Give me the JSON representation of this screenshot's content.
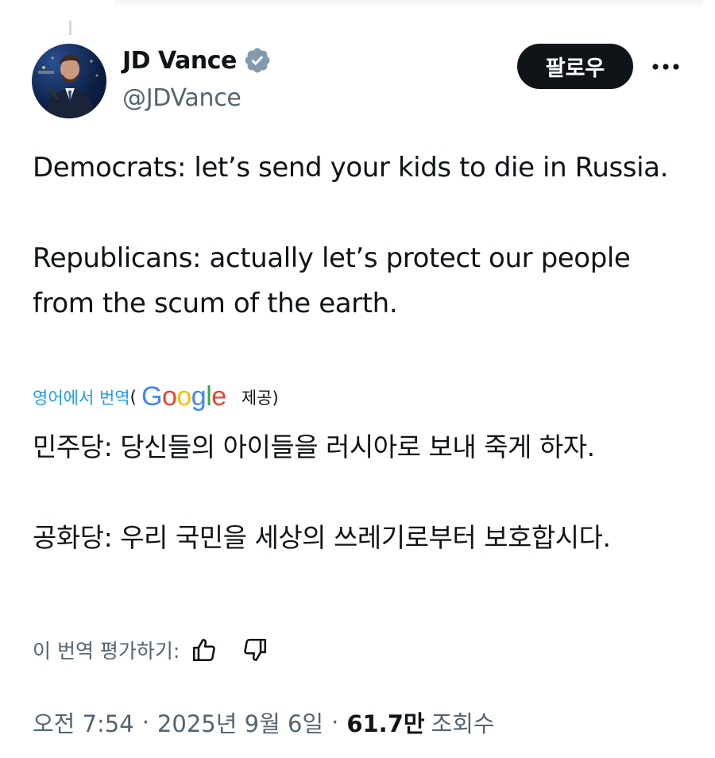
{
  "author": {
    "display_name": "JD Vance",
    "handle": "@JDVance",
    "verified_color": "#829aab"
  },
  "actions": {
    "follow_label": "팔로우",
    "more_icon": "more-horizontal-icon"
  },
  "tweet": {
    "paragraphs": [
      "Democrats: let’s send your kids to die in Russia.",
      "Republicans: actually let’s protect our people from the scum of the earth."
    ]
  },
  "translation": {
    "link_label": "영어에서 번역",
    "open_paren": "(",
    "provider": "Google",
    "provided_label": "제공)",
    "paragraphs": [
      "민주당: 당신들의 아이들을 러시아로 보내 죽게 하자.",
      "공화당: 우리 국민을 세상의 쓰레기로부터 보호합시다."
    ],
    "rate_label": "이 번역 평가하기:"
  },
  "meta": {
    "time": "오전 7:54",
    "date": "2025년 9월 6일",
    "separator": "·",
    "views_count": "61.7만",
    "views_label": "조회수"
  },
  "colors": {
    "text": "#0f1419",
    "secondary": "#536471",
    "link": "#1d9bf0",
    "button_bg": "#0f1419"
  }
}
